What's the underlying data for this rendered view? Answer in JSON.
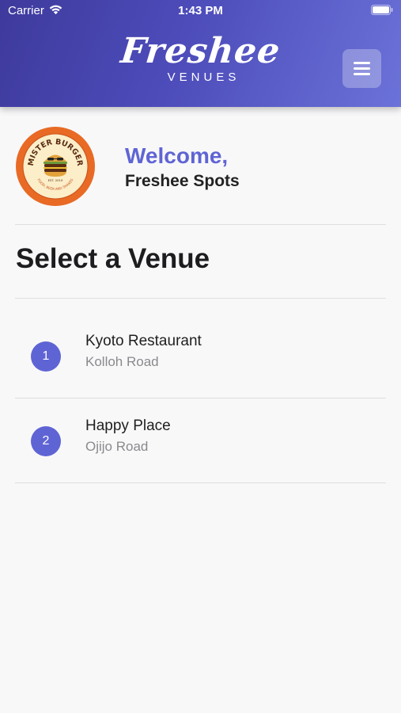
{
  "status_bar": {
    "carrier": "Carrier",
    "time": "1:43 PM",
    "wifi_icon": "wifi-icon",
    "battery_icon": "battery-icon"
  },
  "header": {
    "logo_script": "Freshee",
    "logo_sub": "VENUES",
    "menu_icon": "hamburger-menu-icon",
    "gradient_start": "#3e3a9c",
    "gradient_end": "#6b72d8"
  },
  "welcome": {
    "title": "Welcome,",
    "name": "Freshee Spots",
    "avatar": {
      "brand": "MISTER BURGER",
      "tagline": "FOOD, BEER AND SHAKES",
      "est": "EST. 2019"
    },
    "accent_color": "#5f64d4"
  },
  "main": {
    "section_title": "Select a Venue",
    "venues": [
      {
        "index": "1",
        "name": "Kyoto Restaurant",
        "address": "Kolloh Road"
      },
      {
        "index": "2",
        "name": "Happy Place",
        "address": "Ojijo Road"
      }
    ]
  }
}
